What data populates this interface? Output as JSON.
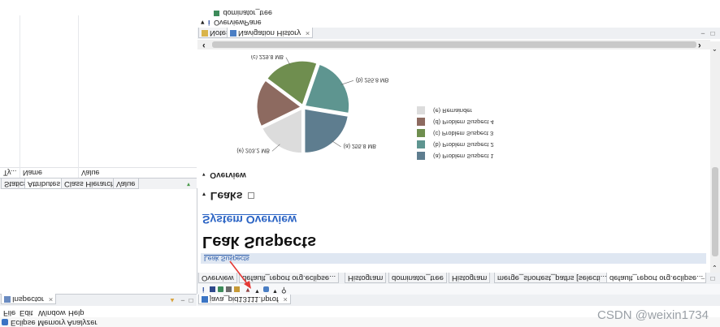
{
  "window": {
    "title": "Eclipse Memory Analyzer",
    "menu": [
      "File",
      "Edit",
      "Window",
      "Help"
    ]
  },
  "left_panel": {
    "inspector_tab": "Inspector",
    "tabs": [
      "Statics",
      "Attributes",
      "Class Hierarchy",
      "Value"
    ],
    "columns": [
      "Ty...",
      "Name",
      "Value"
    ]
  },
  "editor": {
    "file_tab": "java_pid13111.hprof",
    "subtabs": [
      "Overview",
      "default_report  org.eclipse...",
      "Histogram",
      "dominator_tree",
      "Histogram",
      "merge_shortest_paths [selecti...",
      "default_report  org.eclipse..."
    ],
    "breadcrumb": "Leak Suspects",
    "heading": "Leak Suspects",
    "subheading": "System Overview",
    "leaks_label": "Leaks",
    "overview_label": "Overview"
  },
  "bottom_panel": {
    "tabs": [
      "Notes",
      "Navigation History"
    ],
    "tree": [
      "OverviewPane",
      "dominator_tree"
    ]
  },
  "chart_data": {
    "type": "pie",
    "slices": [
      {
        "label": "(a)  Problem Suspect 1",
        "value": 255.8,
        "size_label": "(a)  255.8 MB",
        "color": "#5e7d8f"
      },
      {
        "label": "(b)  Problem Suspect 2",
        "value": 255.8,
        "size_label": "(b)  255.8 MB",
        "color": "#5e9590"
      },
      {
        "label": "(c)  Problem Suspect 3",
        "value": 229.8,
        "size_label": "(c)  229.8 MB",
        "color": "#6f8e4f"
      },
      {
        "label": "(d)  Problem Suspect 4",
        "value": 200,
        "size_label": "",
        "color": "#8d6a60"
      },
      {
        "label": "(e)  Remainder",
        "value": 203.2,
        "size_label": "(e)  203.2 MB",
        "color": "#dcdcdc"
      }
    ]
  },
  "watermark": "CSDN @weixin1734"
}
